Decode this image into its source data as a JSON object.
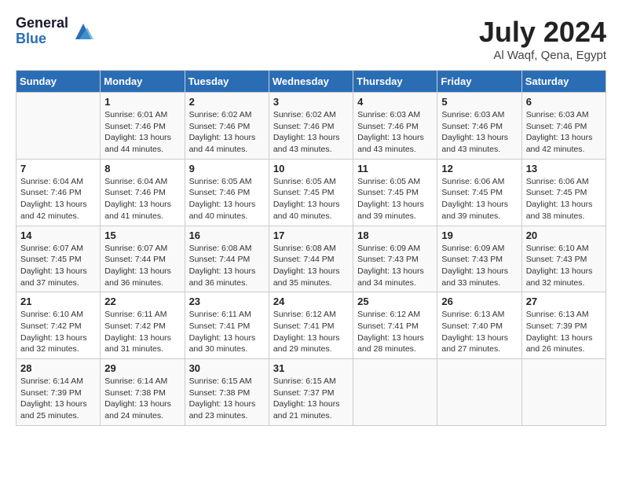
{
  "logo": {
    "general": "General",
    "blue": "Blue"
  },
  "title": "July 2024",
  "location": "Al Waqf, Qena, Egypt",
  "weekdays": [
    "Sunday",
    "Monday",
    "Tuesday",
    "Wednesday",
    "Thursday",
    "Friday",
    "Saturday"
  ],
  "weeks": [
    [
      null,
      {
        "day": 1,
        "sunrise": "6:01 AM",
        "sunset": "7:46 PM",
        "daylight": "13 hours and 44 minutes."
      },
      {
        "day": 2,
        "sunrise": "6:02 AM",
        "sunset": "7:46 PM",
        "daylight": "13 hours and 44 minutes."
      },
      {
        "day": 3,
        "sunrise": "6:02 AM",
        "sunset": "7:46 PM",
        "daylight": "13 hours and 43 minutes."
      },
      {
        "day": 4,
        "sunrise": "6:03 AM",
        "sunset": "7:46 PM",
        "daylight": "13 hours and 43 minutes."
      },
      {
        "day": 5,
        "sunrise": "6:03 AM",
        "sunset": "7:46 PM",
        "daylight": "13 hours and 43 minutes."
      },
      {
        "day": 6,
        "sunrise": "6:03 AM",
        "sunset": "7:46 PM",
        "daylight": "13 hours and 42 minutes."
      }
    ],
    [
      {
        "day": 7,
        "sunrise": "6:04 AM",
        "sunset": "7:46 PM",
        "daylight": "13 hours and 42 minutes."
      },
      {
        "day": 8,
        "sunrise": "6:04 AM",
        "sunset": "7:46 PM",
        "daylight": "13 hours and 41 minutes."
      },
      {
        "day": 9,
        "sunrise": "6:05 AM",
        "sunset": "7:46 PM",
        "daylight": "13 hours and 40 minutes."
      },
      {
        "day": 10,
        "sunrise": "6:05 AM",
        "sunset": "7:45 PM",
        "daylight": "13 hours and 40 minutes."
      },
      {
        "day": 11,
        "sunrise": "6:05 AM",
        "sunset": "7:45 PM",
        "daylight": "13 hours and 39 minutes."
      },
      {
        "day": 12,
        "sunrise": "6:06 AM",
        "sunset": "7:45 PM",
        "daylight": "13 hours and 39 minutes."
      },
      {
        "day": 13,
        "sunrise": "6:06 AM",
        "sunset": "7:45 PM",
        "daylight": "13 hours and 38 minutes."
      }
    ],
    [
      {
        "day": 14,
        "sunrise": "6:07 AM",
        "sunset": "7:45 PM",
        "daylight": "13 hours and 37 minutes."
      },
      {
        "day": 15,
        "sunrise": "6:07 AM",
        "sunset": "7:44 PM",
        "daylight": "13 hours and 36 minutes."
      },
      {
        "day": 16,
        "sunrise": "6:08 AM",
        "sunset": "7:44 PM",
        "daylight": "13 hours and 36 minutes."
      },
      {
        "day": 17,
        "sunrise": "6:08 AM",
        "sunset": "7:44 PM",
        "daylight": "13 hours and 35 minutes."
      },
      {
        "day": 18,
        "sunrise": "6:09 AM",
        "sunset": "7:43 PM",
        "daylight": "13 hours and 34 minutes."
      },
      {
        "day": 19,
        "sunrise": "6:09 AM",
        "sunset": "7:43 PM",
        "daylight": "13 hours and 33 minutes."
      },
      {
        "day": 20,
        "sunrise": "6:10 AM",
        "sunset": "7:43 PM",
        "daylight": "13 hours and 32 minutes."
      }
    ],
    [
      {
        "day": 21,
        "sunrise": "6:10 AM",
        "sunset": "7:42 PM",
        "daylight": "13 hours and 32 minutes."
      },
      {
        "day": 22,
        "sunrise": "6:11 AM",
        "sunset": "7:42 PM",
        "daylight": "13 hours and 31 minutes."
      },
      {
        "day": 23,
        "sunrise": "6:11 AM",
        "sunset": "7:41 PM",
        "daylight": "13 hours and 30 minutes."
      },
      {
        "day": 24,
        "sunrise": "6:12 AM",
        "sunset": "7:41 PM",
        "daylight": "13 hours and 29 minutes."
      },
      {
        "day": 25,
        "sunrise": "6:12 AM",
        "sunset": "7:41 PM",
        "daylight": "13 hours and 28 minutes."
      },
      {
        "day": 26,
        "sunrise": "6:13 AM",
        "sunset": "7:40 PM",
        "daylight": "13 hours and 27 minutes."
      },
      {
        "day": 27,
        "sunrise": "6:13 AM",
        "sunset": "7:39 PM",
        "daylight": "13 hours and 26 minutes."
      }
    ],
    [
      {
        "day": 28,
        "sunrise": "6:14 AM",
        "sunset": "7:39 PM",
        "daylight": "13 hours and 25 minutes."
      },
      {
        "day": 29,
        "sunrise": "6:14 AM",
        "sunset": "7:38 PM",
        "daylight": "13 hours and 24 minutes."
      },
      {
        "day": 30,
        "sunrise": "6:15 AM",
        "sunset": "7:38 PM",
        "daylight": "13 hours and 23 minutes."
      },
      {
        "day": 31,
        "sunrise": "6:15 AM",
        "sunset": "7:37 PM",
        "daylight": "13 hours and 21 minutes."
      },
      null,
      null,
      null
    ]
  ]
}
